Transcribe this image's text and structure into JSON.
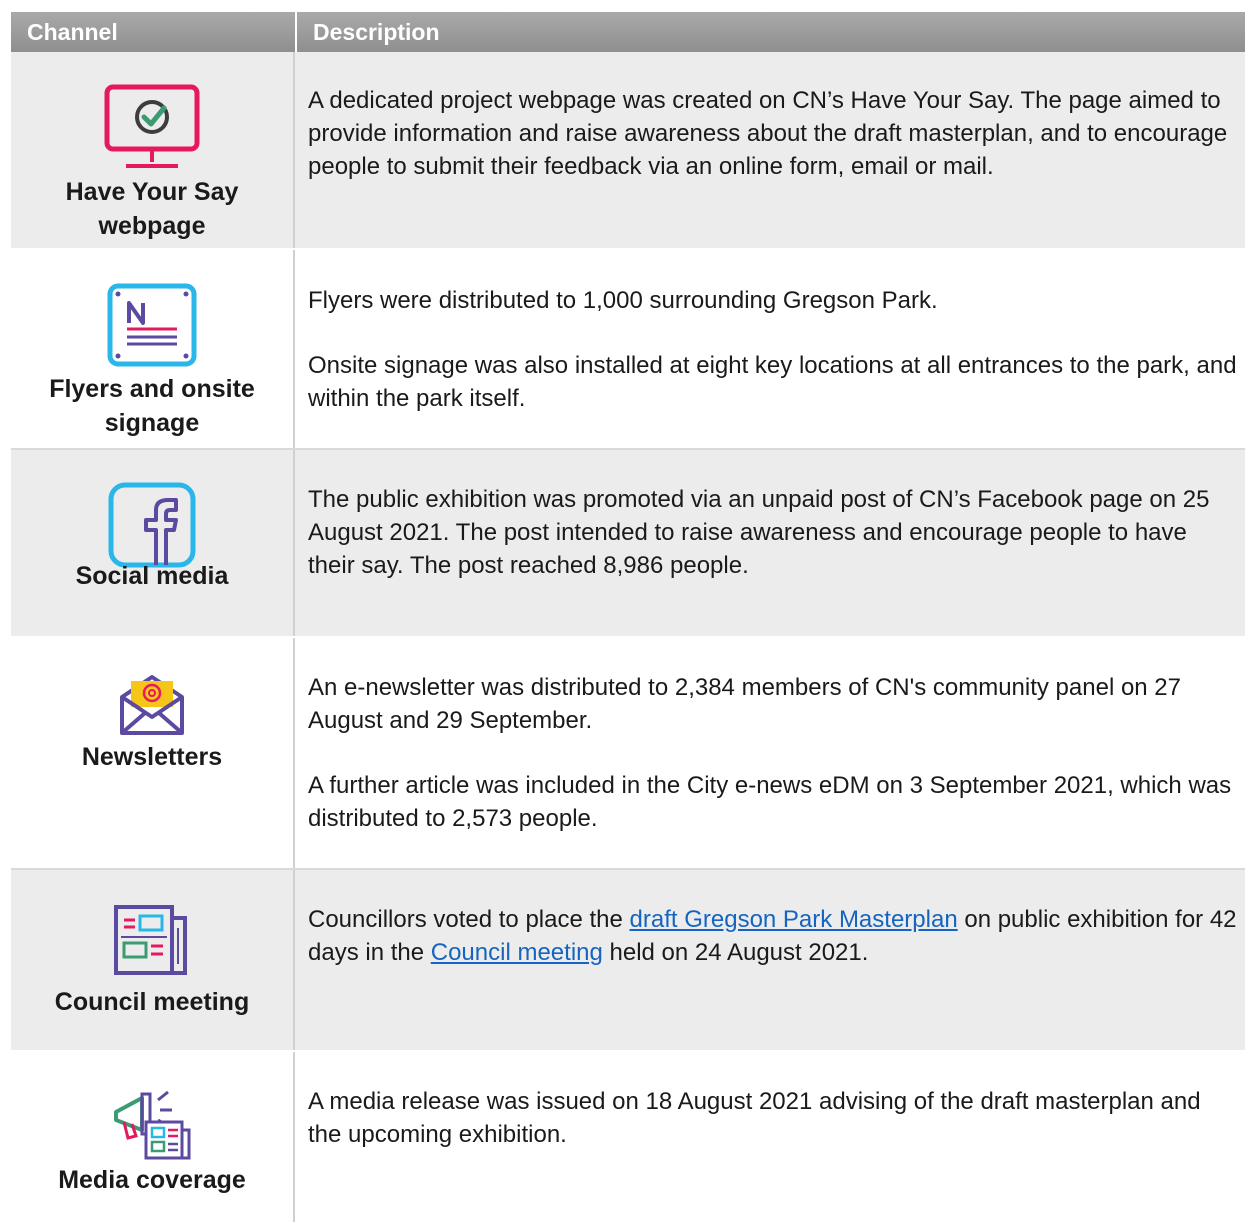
{
  "header": {
    "channel_label": "Channel",
    "description_label": "Description"
  },
  "rows": [
    {
      "channel": "Have Your Say webpage",
      "icon": "monitor-checkmark-icon",
      "paragraphs": [
        "A dedicated project webpage was created on CN’s Have Your Say. The page aimed to provide information and raise awareness about the draft masterplan, and to encourage people to submit their feedback via an online form, email or mail."
      ]
    },
    {
      "channel": "Flyers and onsite signage",
      "icon": "flyer-sign-icon",
      "paragraphs": [
        "Flyers were distributed to 1,000 surrounding Gregson Park.",
        "Onsite signage was also installed at eight key locations at all entrances to the park, and within the park itself."
      ]
    },
    {
      "channel": "Social media",
      "icon": "facebook-icon",
      "paragraphs": [
        "The public exhibition was promoted via an unpaid post of CN’s Facebook page on 25 August 2021. The post intended to raise awareness and encourage people to have their say. The post reached 8,986 people."
      ]
    },
    {
      "channel": "Newsletters",
      "icon": "envelope-at-icon",
      "paragraphs": [
        "An e-newsletter was distributed to 2,384 members of CN's community panel on 27 August and 29 September.",
        "A further article was included in the City e-news eDM on 3 September 2021, which was distributed to 2,573 people."
      ]
    },
    {
      "channel": "Council meeting",
      "icon": "newspaper-icon",
      "text_before_link1": "Councillors voted to place the ",
      "link1": "draft Gregson Park Masterplan",
      "text_between": " on public exhibition for 42 days in the ",
      "link2": "Council meeting",
      "text_after": " held on 24 August 2021."
    },
    {
      "channel": "Media coverage",
      "icon": "megaphone-newspaper-icon",
      "paragraphs": [
        "A media release was issued on 18 August 2021 advising of the draft masterplan and the upcoming exhibition."
      ]
    }
  ],
  "colors": {
    "header_bg": "#999999",
    "row_alt_bg": "#ececec",
    "link": "#1565c0",
    "pink": "#e5195f",
    "cyan": "#29b6e8",
    "purple": "#5b4aa0",
    "green": "#3d9b74"
  }
}
